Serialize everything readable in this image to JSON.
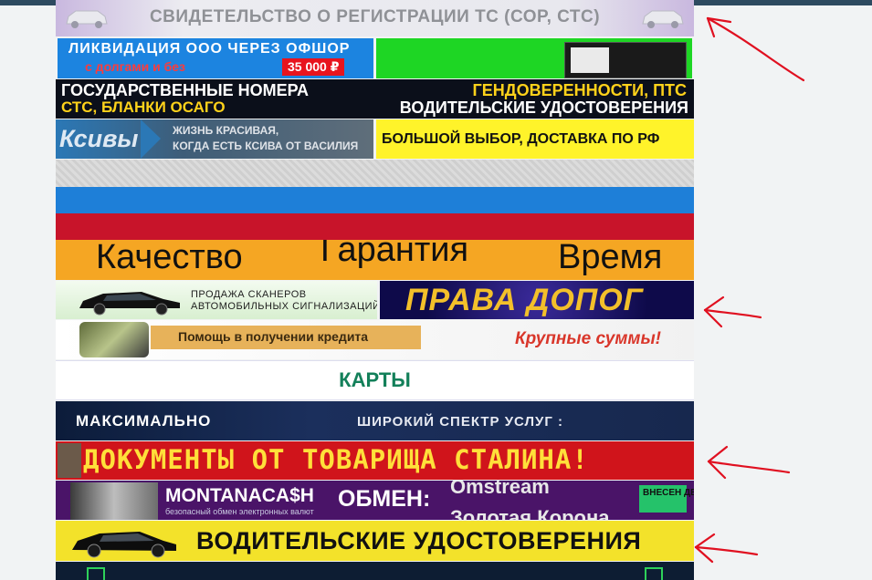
{
  "banners": {
    "registration": "СВИДЕТЕЛЬСТВО О РЕГИСТРАЦИИ ТС (СОР, СТС)",
    "liquidation": {
      "line1": "ЛИКВИДАЦИЯ ООО ЧЕРЕЗ ОФШОР",
      "line2": "с долгами и без",
      "price": "35 000 ₽"
    },
    "plates": {
      "left1": "ГОСУДАРСТВЕННЫЕ НОМЕРА",
      "left2": "СТС, БЛАНКИ ОСАГО",
      "right1": "ГЕНДОВЕРЕННОСТИ, ПТС",
      "right2": "ВОДИТЕЛЬСКИЕ УДОСТОВЕРЕНИЯ"
    },
    "ksivy": {
      "logo": "Ксивы",
      "line1": "ЖИЗНЬ КРАСИВАЯ,",
      "line2": "КОГДА ЕСТЬ КСИВА ОТ ВАСИЛИЯ"
    },
    "delivery": "БОЛЬШОЙ ВЫБОР, ДОСТАВКА ПО РФ",
    "quality": {
      "a": "Качество",
      "b": "Гарантия",
      "c": "Время"
    },
    "scanners": {
      "line1": "ПРОДАЖА СКАНЕРОВ",
      "line2": "АВТОМОБИЛЬНЫХ СИГНАЛИЗАЦИЙ"
    },
    "prava": "ПРАВА ДОПОГ",
    "credit": {
      "ribbon": "Помощь в получении кредита",
      "right": "Крупные суммы!"
    },
    "cards": "КАРТЫ",
    "maximalno": {
      "left": "МАКСИМАЛЬНО",
      "right": "ШИРОКИЙ СПЕКТР УСЛУГ :"
    },
    "stalin": "ДОКУМЕНТЫ ОТ ТОВАРИЩА СТАЛИНА!",
    "montana": {
      "brand": "MONTANACA$H",
      "sub": "безопасный обмен электронных валют",
      "exchange": "ОБМЕН:",
      "line1": "Omstream",
      "line2": "Золотая Корона",
      "deposit": "ВНЕСЕН ДЕПОЗИТ"
    },
    "drivers": "ВОДИТЕЛЬСКИЕ УДОСТОВЕРЕНИЯ"
  },
  "colors": {
    "annotation_arrow": "#e01020",
    "page_bg": "#f1f3f4",
    "top_bar": "#2d4a60"
  }
}
